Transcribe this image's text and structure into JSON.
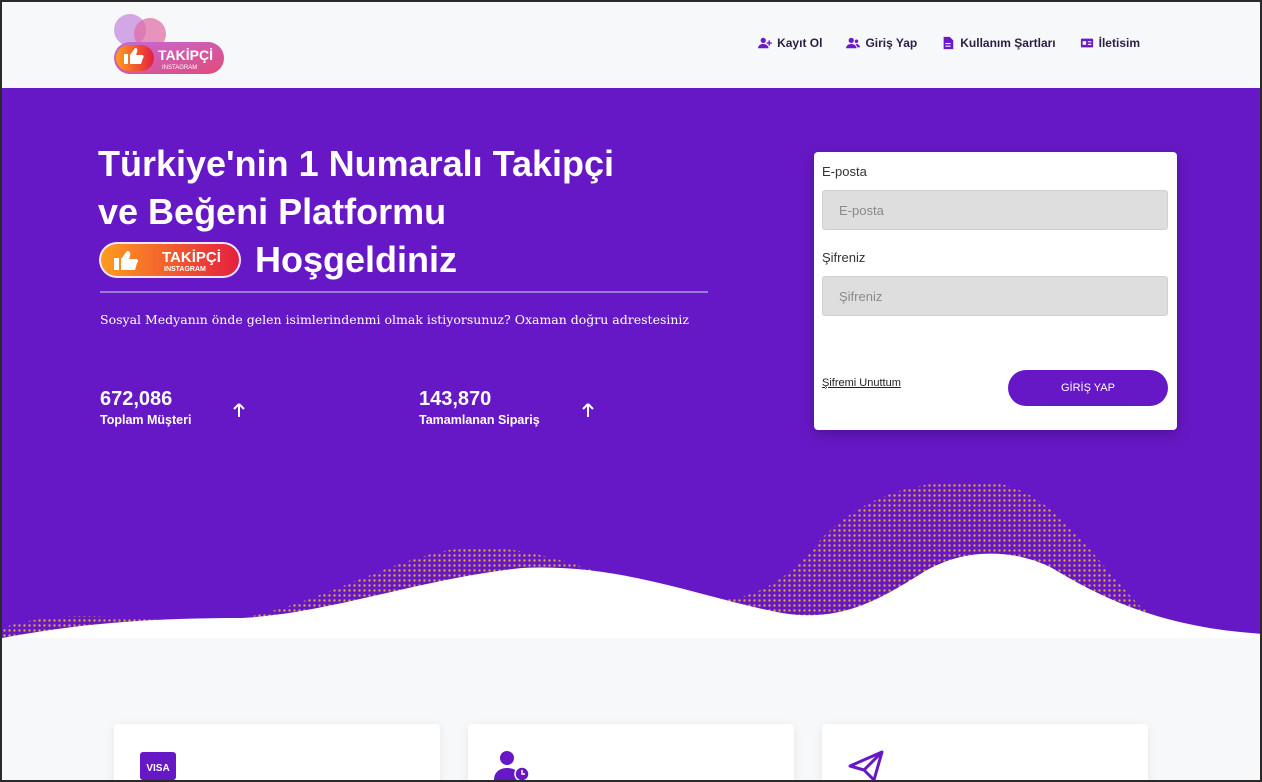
{
  "header": {
    "logo": {
      "brand": "TAKİPÇİ",
      "sub": "INSTAGRAM",
      "icon": "thumbs-up-icon"
    },
    "nav": [
      {
        "label": "Kayıt Ol",
        "icon": "user-plus-icon"
      },
      {
        "label": "Giriş Yap",
        "icon": "users-icon"
      },
      {
        "label": "Kullanım Şartları",
        "icon": "document-icon"
      },
      {
        "label": "İletisim",
        "icon": "contact-card-icon"
      }
    ]
  },
  "hero": {
    "title_line1": "Türkiye'nin 1 Numaralı Takipçi",
    "title_line2": "ve Beğeni Platformu",
    "title_line3": "Hoşgeldiniz",
    "description": "Sosyal Medyanın önde gelen isimlerindenmi olmak istiyorsunuz? Oxaman doğru adrestesiniz",
    "stats": [
      {
        "value": "672,086",
        "label": "Toplam Müşteri",
        "icon": "arrow-up-icon"
      },
      {
        "value": "143,870",
        "label": "Tamamlanan Sipariş",
        "icon": "arrow-up-icon"
      }
    ]
  },
  "login": {
    "email_label": "E-posta",
    "email_placeholder": "E-posta",
    "password_label": "Şifreniz",
    "password_placeholder": "Şifreniz",
    "forgot_label": "Şifremi Unuttum",
    "submit_label": "GİRİŞ YAP"
  },
  "cards": [
    {
      "icon": "visa-card-icon"
    },
    {
      "icon": "user-clock-icon"
    },
    {
      "icon": "paper-plane-icon"
    }
  ],
  "colors": {
    "primary": "#6718c6",
    "dots": "#d9a43a",
    "background": "#f7f8fa"
  }
}
